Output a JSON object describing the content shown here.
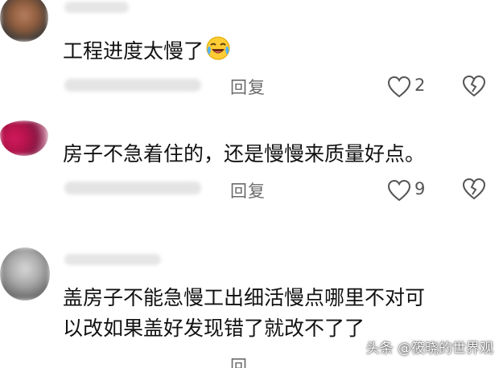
{
  "comments": [
    {
      "text": "工程进度太慢了",
      "emoji": "crying-laughing-emoji",
      "reply_label": "回复",
      "like_count": "2"
    },
    {
      "text": "房子不急着住的，还是慢慢来质量好点。",
      "reply_label": "回复",
      "like_count": "9"
    },
    {
      "text_line1": "盖房子不能急慢工出细活慢点哪里不对可",
      "text_line2": "以改如果盖好发现错了就改不了了",
      "reply_label": "回"
    }
  ],
  "watermark": "头条 @筱晓的世界观",
  "icons": {
    "like": "heart-outline-icon",
    "dislike": "broken-heart-icon"
  }
}
